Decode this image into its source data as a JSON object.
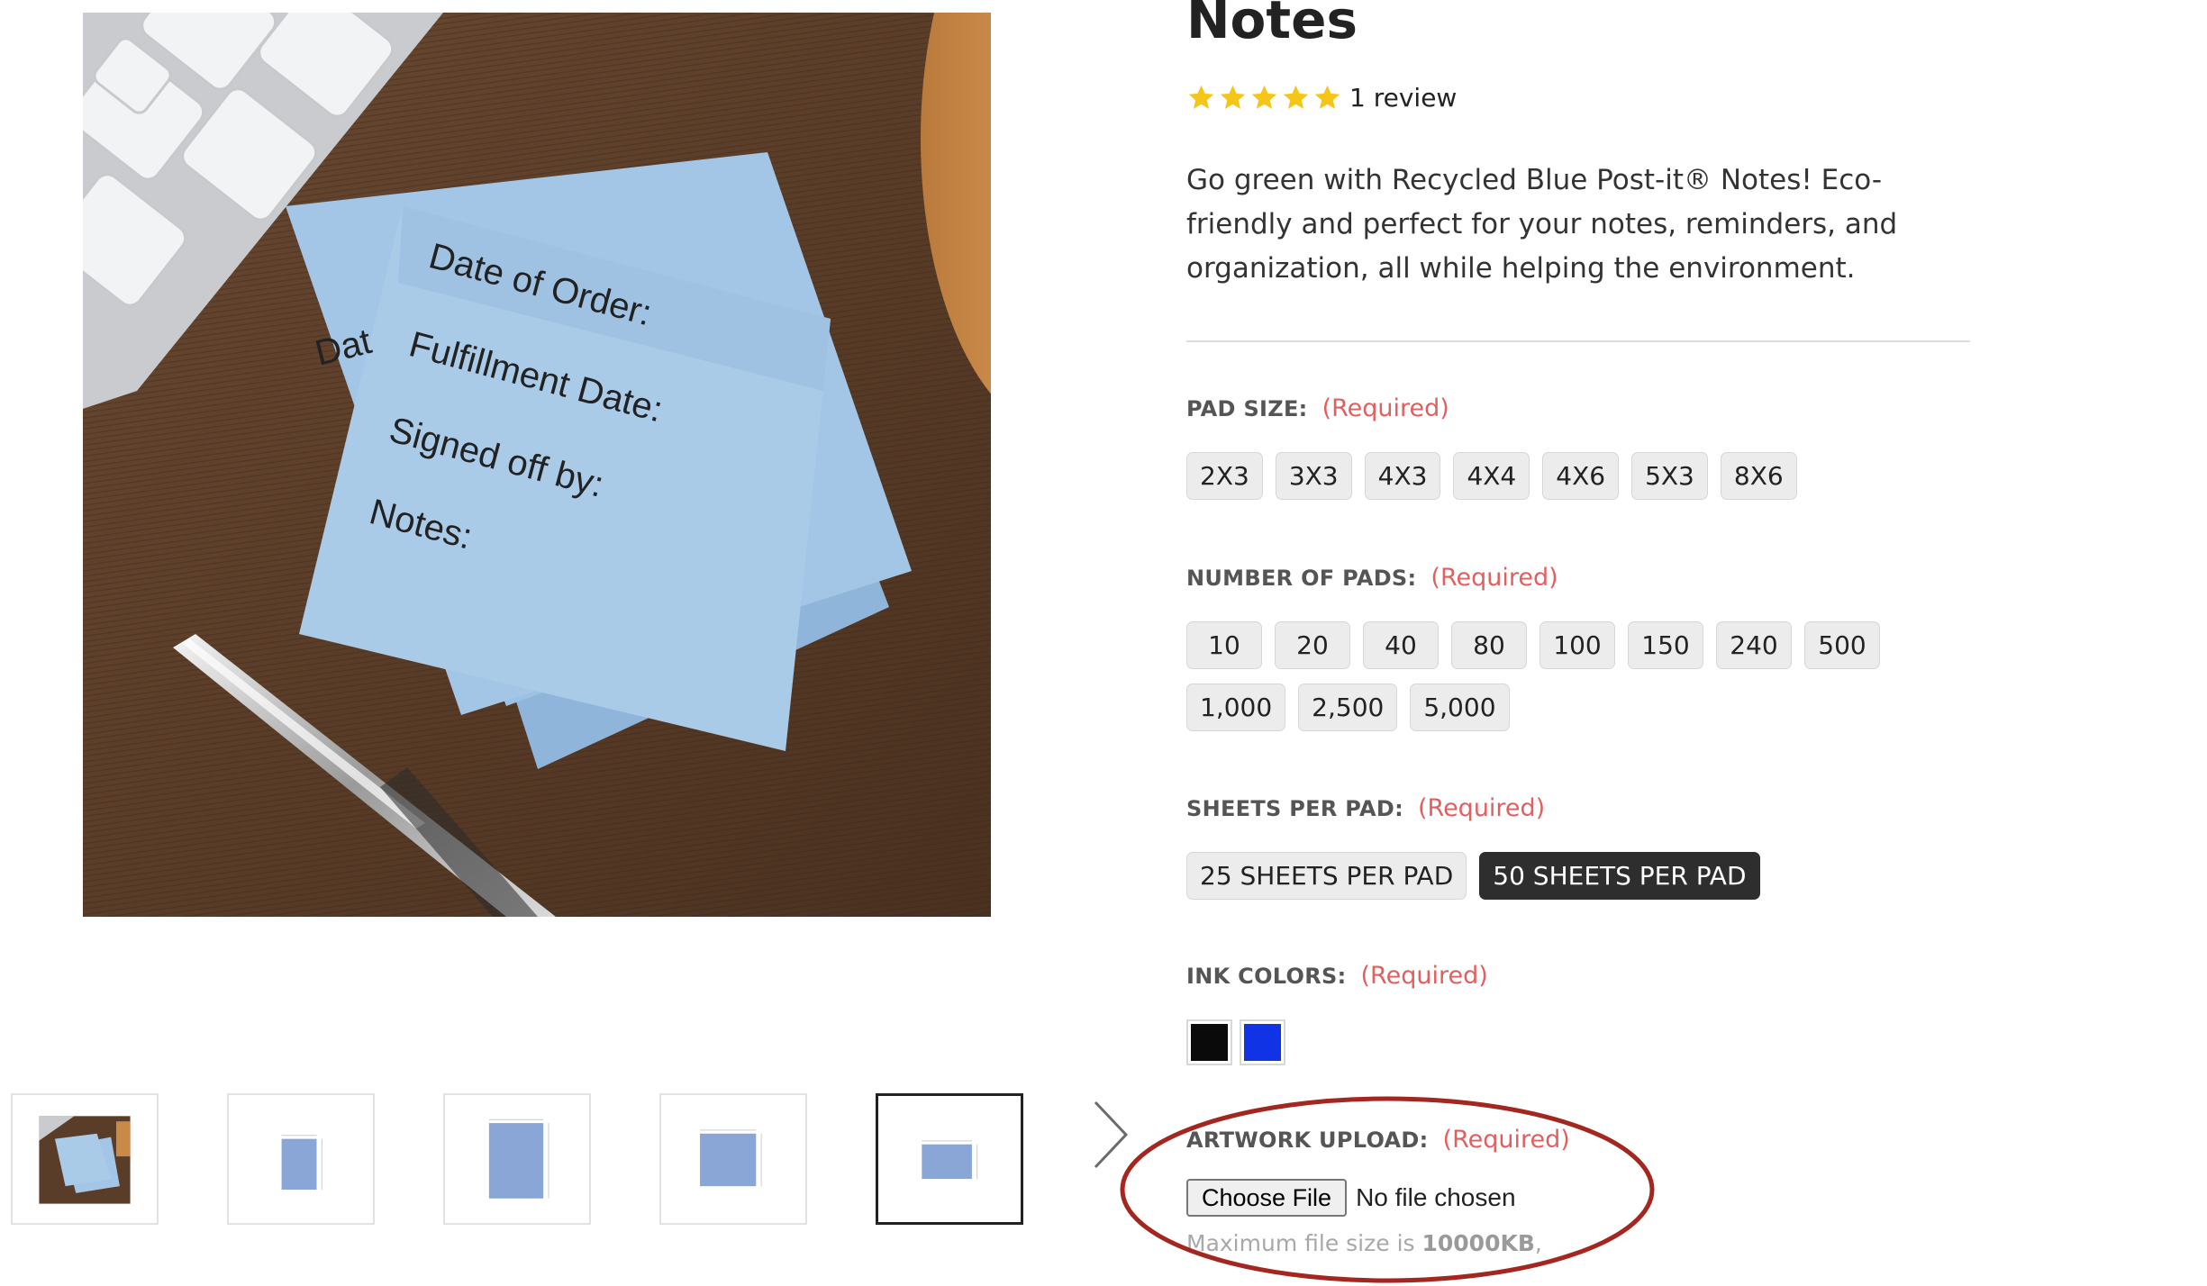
{
  "product": {
    "title": "Notes",
    "rating_stars": 5,
    "review_count": "1 review",
    "description": "Go green with Recycled Blue Post-it® Notes! Eco-friendly and perfect for your notes, reminders, and organization, all while helping the environment."
  },
  "main_image": {
    "note_lines": [
      "Date of Order:",
      "Fulfillment Date:",
      "Signed off by:",
      "Notes:"
    ],
    "under_note_text": "Dat"
  },
  "thumbnails": [
    {
      "icon": "product-photo-thumb",
      "active": false
    },
    {
      "icon": "pad-2x3-diagram-thumb",
      "active": false
    },
    {
      "icon": "pad-3x4-diagram-thumb",
      "active": false
    },
    {
      "icon": "pad-3x3-diagram-thumb",
      "active": false
    },
    {
      "icon": "pad-3x2-diagram-thumb",
      "active": true
    }
  ],
  "options": {
    "pad_size": {
      "label": "PAD SIZE:",
      "required": "(Required)",
      "values": [
        "2X3",
        "3X3",
        "4X3",
        "4X4",
        "4X6",
        "5X3",
        "8X6"
      ]
    },
    "number_of_pads": {
      "label": "NUMBER OF PADS:",
      "required": "(Required)",
      "values": [
        "10",
        "20",
        "40",
        "80",
        "100",
        "150",
        "240",
        "500",
        "1,000",
        "2,500",
        "5,000"
      ]
    },
    "sheets_per_pad": {
      "label": "SHEETS PER PAD:",
      "required": "(Required)",
      "values": [
        "25 SHEETS PER PAD",
        "50 SHEETS PER PAD"
      ],
      "selected": "50 SHEETS PER PAD"
    },
    "ink_colors": {
      "label": "INK COLORS:",
      "required": "(Required)",
      "swatches": [
        {
          "name": "black",
          "color": "#0a0a0a"
        },
        {
          "name": "blue",
          "color": "#1133e6"
        }
      ]
    }
  },
  "artwork_upload": {
    "label": "ARTWORK UPLOAD:",
    "required": "(Required)",
    "button": "Choose File",
    "status": "No file chosen",
    "hint_prefix": "Maximum file size is ",
    "hint_size": "10000KB",
    "hint_suffix": ","
  },
  "colors": {
    "accent_required": "#e06060",
    "selected_button": "#2e2e2e",
    "highlight_ellipse": "#a3261f",
    "star": "#f5c518",
    "note_blue": "#a9cbe8"
  },
  "icons": {
    "next": "chevron-right-icon",
    "star": "star-icon"
  }
}
